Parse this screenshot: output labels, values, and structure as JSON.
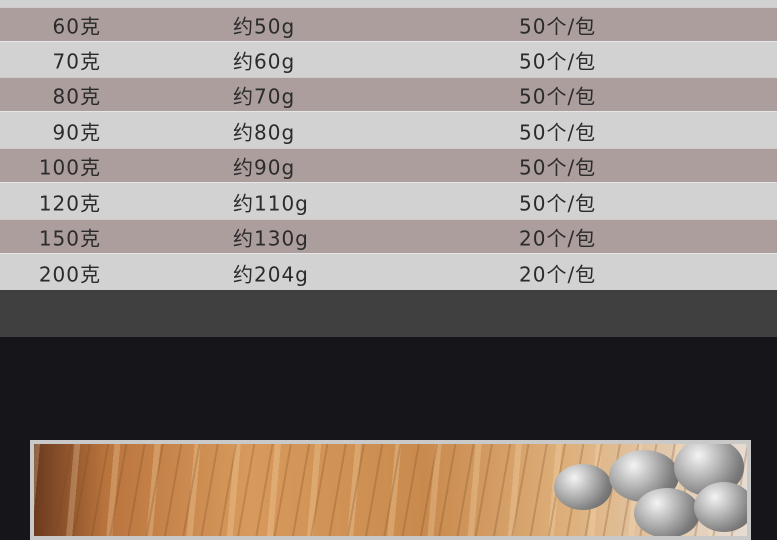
{
  "table": {
    "rows": [
      {
        "weight": "60克",
        "approx": "约50g",
        "pack": "50个/包"
      },
      {
        "weight": "70克",
        "approx": "约60g",
        "pack": "50个/包"
      },
      {
        "weight": "80克",
        "approx": "约70g",
        "pack": "50个/包"
      },
      {
        "weight": "90克",
        "approx": "约80g",
        "pack": "50个/包"
      },
      {
        "weight": "100克",
        "approx": "约90g",
        "pack": "50个/包"
      },
      {
        "weight": "120克",
        "approx": "约110g",
        "pack": "50个/包"
      },
      {
        "weight": "150克",
        "approx": "约130g",
        "pack": "20个/包"
      },
      {
        "weight": "200克",
        "approx": "约204g",
        "pack": "20个/包"
      }
    ]
  },
  "colors": {
    "row_dark": "#ab9e9d",
    "row_light": "#d2d2d2",
    "text": "#2b2b2b",
    "strip": "#404040",
    "background": "#16161a"
  },
  "product_photo": {
    "subject": "lead-sinkers-on-wood-icon"
  }
}
